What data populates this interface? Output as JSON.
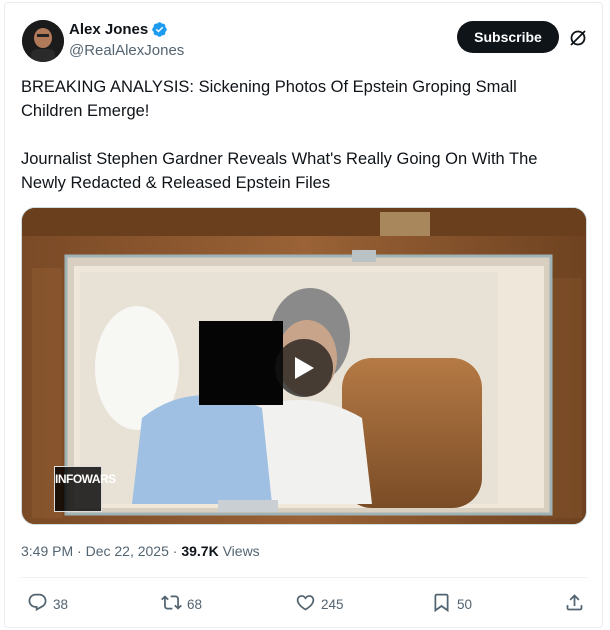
{
  "author": {
    "name": "Alex Jones",
    "handle": "@RealAlexJones",
    "verified_color": "#1d9bf0"
  },
  "header": {
    "subscribe_label": "Subscribe",
    "grok_icon": "grok-icon"
  },
  "tweet": {
    "text": "BREAKING ANALYSIS: Sickening Photos Of Epstein Groping Small Children Emerge!\n\nJournalist Stephen Gardner Reveals What's Really Going On With The Newly Redacted & Released Epstein Files"
  },
  "media": {
    "type": "video",
    "watermark": "INFOWARS",
    "play_icon": "play-icon"
  },
  "meta": {
    "time": "3:49 PM",
    "separator": "·",
    "date": "Dec 22, 2025",
    "views_count": "39.7K",
    "views_label": "Views"
  },
  "actions": {
    "replies": "38",
    "reposts": "68",
    "likes": "245",
    "bookmarks": "50"
  },
  "colors": {
    "text": "#0f1419",
    "secondary": "#536471",
    "accent": "#1d9bf0"
  }
}
